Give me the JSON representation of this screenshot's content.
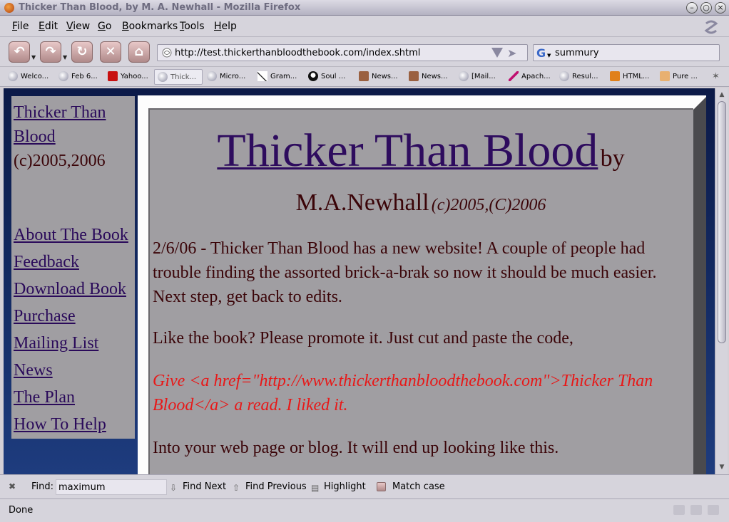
{
  "window": {
    "title": "Thicker Than Blood, by M. A. Newhall - Mozilla Firefox"
  },
  "menu": {
    "items": [
      {
        "label": "File",
        "key": "F",
        "rest": "ile"
      },
      {
        "label": "Edit",
        "key": "E",
        "rest": "dit"
      },
      {
        "label": "View",
        "key": "V",
        "rest": "iew"
      },
      {
        "label": "Go",
        "key": "G",
        "rest": "o"
      },
      {
        "label": "Bookmarks",
        "key": "B",
        "rest": "ookmarks"
      },
      {
        "label": "Tools",
        "key": "T",
        "rest": "ools"
      },
      {
        "label": "Help",
        "key": "H",
        "rest": "elp"
      }
    ]
  },
  "nav": {
    "url": "http://test.thickerthanbloodthebook.com/index.shtml",
    "search_value": "summury",
    "search_engine": "G"
  },
  "bookmarks": [
    {
      "label": "Welco..."
    },
    {
      "label": "Feb 6..."
    },
    {
      "label": "Yahoo..."
    },
    {
      "label": "Thick..."
    },
    {
      "label": "Micro..."
    },
    {
      "label": "Gram..."
    },
    {
      "label": "Soul ..."
    },
    {
      "label": "News..."
    },
    {
      "label": "News..."
    },
    {
      "label": "[Mail..."
    },
    {
      "label": "Apach..."
    },
    {
      "label": "Resul..."
    },
    {
      "label": "HTML..."
    },
    {
      "label": "Pure ..."
    }
  ],
  "sidebar": {
    "title_line1": "Thicker Than",
    "title_line2": "Blood",
    "copyright": "(c)2005,2006",
    "links": [
      "About The Book",
      "Feedback",
      "Download Book",
      "Purchase",
      "Mailing List",
      "News",
      "The Plan",
      "How To Help"
    ]
  },
  "main": {
    "heading": "Thicker Than Blood",
    "by": "by",
    "author": "M.A.Newhall",
    "author_copyright": "(c)2005,(C)2006",
    "para1": "2/6/06 - Thicker Than Blood has a new website! A couple of people had trouble finding the assorted brick-a-brak so now it should be much easier. Next step, get back to edits.",
    "para2": "Like the book? Please promote it. Just cut and paste the code,",
    "code": "Give <a href=\"http://www.thickerthanbloodthebook.com\">Thicker Than Blood</a> a read. I liked it.",
    "para3": "Into your web page or blog. It will end up looking like this."
  },
  "findbar": {
    "label": "Find:",
    "value": "maximum",
    "find_next": "Find Next",
    "find_previous": "Find Previous",
    "highlight": "Highlight",
    "match_case": "Match case"
  },
  "status": {
    "text": "Done"
  }
}
